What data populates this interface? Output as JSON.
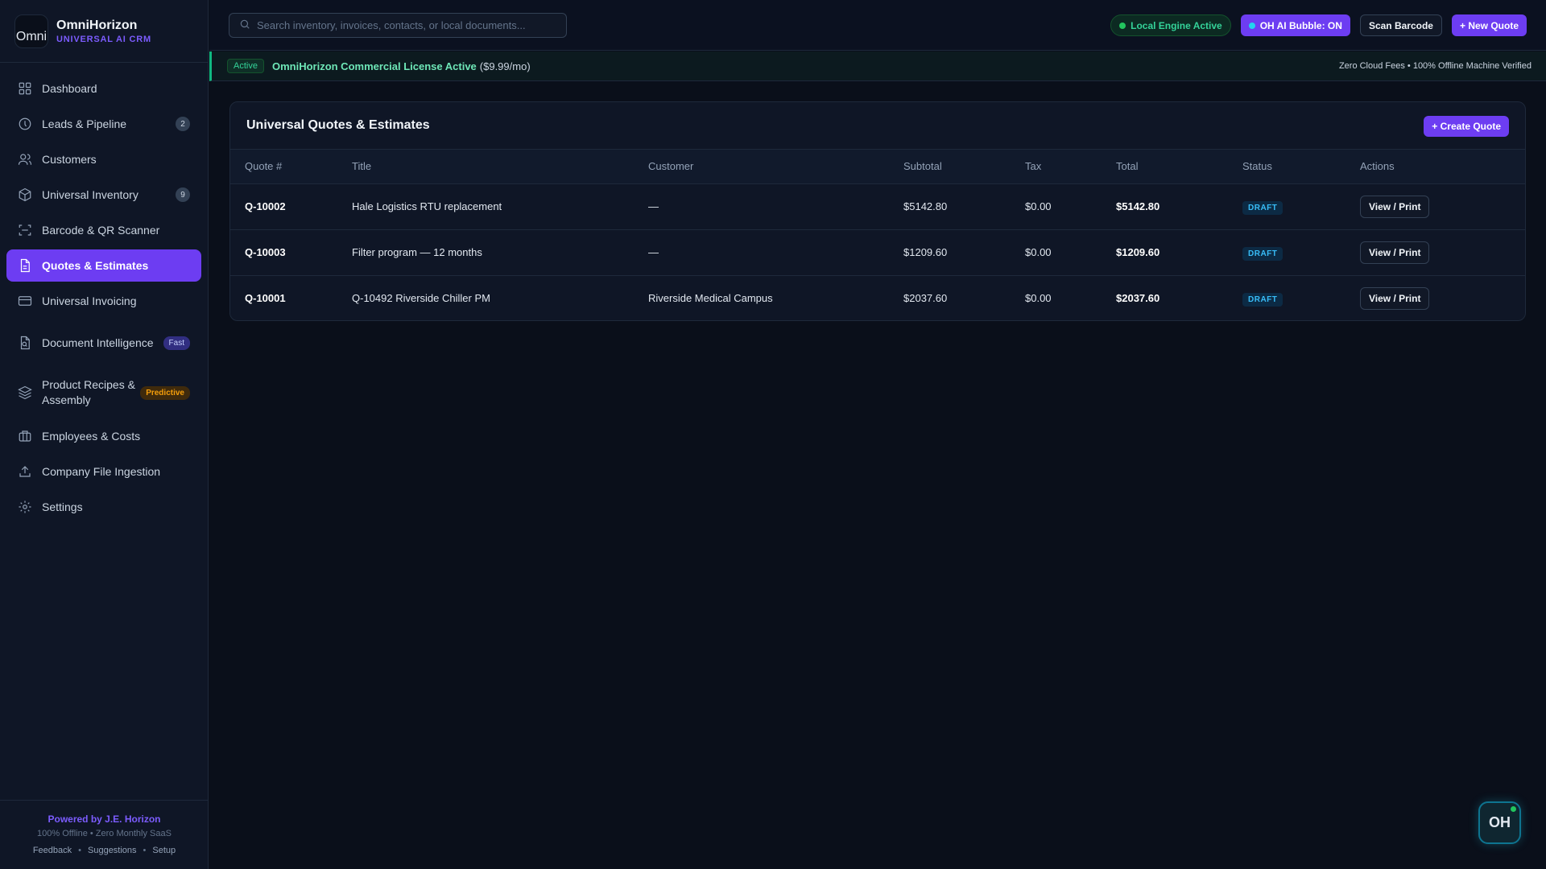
{
  "brand": {
    "logo_text": "Omni",
    "name": "OmniHorizon",
    "subtitle": "UNIVERSAL AI CRM"
  },
  "sidebar": {
    "items": [
      {
        "label": "Dashboard",
        "icon": "grid-icon"
      },
      {
        "label": "Leads & Pipeline",
        "icon": "compass-icon",
        "badge": "2"
      },
      {
        "label": "Customers",
        "icon": "users-icon"
      },
      {
        "label": "Universal Inventory",
        "icon": "box-icon",
        "badge": "9"
      },
      {
        "label": "Barcode & QR Scanner",
        "icon": "scan-icon"
      },
      {
        "label": "Quotes & Estimates",
        "icon": "document-icon",
        "active": true
      },
      {
        "label": "Universal Invoicing",
        "icon": "card-icon"
      },
      {
        "label": "Document Intelligence",
        "icon": "file-search-icon",
        "badge": "Fast"
      },
      {
        "label": "Product Recipes & Assembly",
        "icon": "layers-icon",
        "badge": "Predictive"
      },
      {
        "label": "Employees & Costs",
        "icon": "briefcase-icon"
      },
      {
        "label": "Company File Ingestion",
        "icon": "upload-icon"
      },
      {
        "label": "Settings",
        "icon": "gear-icon"
      }
    ],
    "footer": {
      "powered_by": "Powered by J.E. Horizon",
      "tagline": "100% Offline • Zero Monthly SaaS",
      "links": [
        "Feedback",
        "Suggestions",
        "Setup"
      ],
      "separator": "•"
    }
  },
  "topbar": {
    "search_placeholder": "Search inventory, invoices, contacts, or local documents...",
    "engine_status": "Local Engine Active",
    "ai_bubble": "OH AI Bubble: ON",
    "scan_barcode": "Scan Barcode",
    "new_quote": "+ New Quote"
  },
  "license": {
    "tag": "Active",
    "title": "OmniHorizon Commercial License Active",
    "price": "($9.99/mo)",
    "right_text": "Zero Cloud Fees • 100% Offline Machine Verified"
  },
  "quotes": {
    "title": "Universal Quotes & Estimates",
    "create_button": "+ Create Quote",
    "columns": [
      "Quote #",
      "Title",
      "Customer",
      "Subtotal",
      "Tax",
      "Total",
      "Status",
      "Actions"
    ],
    "rows": [
      {
        "quote": "Q-10002",
        "title": "Hale Logistics RTU replacement",
        "customer": "—",
        "subtotal": "$5142.80",
        "tax": "$0.00",
        "total": "$5142.80",
        "status": "DRAFT",
        "action": "View / Print"
      },
      {
        "quote": "Q-10003",
        "title": "Filter program — 12 months",
        "customer": "—",
        "subtotal": "$1209.60",
        "tax": "$0.00",
        "total": "$1209.60",
        "status": "DRAFT",
        "action": "View / Print"
      },
      {
        "quote": "Q-10001",
        "title": "Q-10492 Riverside Chiller PM",
        "customer": "Riverside Medical Campus",
        "subtotal": "$2037.60",
        "tax": "$0.00",
        "total": "$2037.60",
        "status": "DRAFT",
        "action": "View / Print"
      }
    ]
  },
  "ai_bubble": {
    "label": "OH"
  },
  "colors": {
    "accent": "#6d3df2",
    "success": "#10b981",
    "status_draft": "#38bdf8",
    "background": "#0a0f1a"
  }
}
